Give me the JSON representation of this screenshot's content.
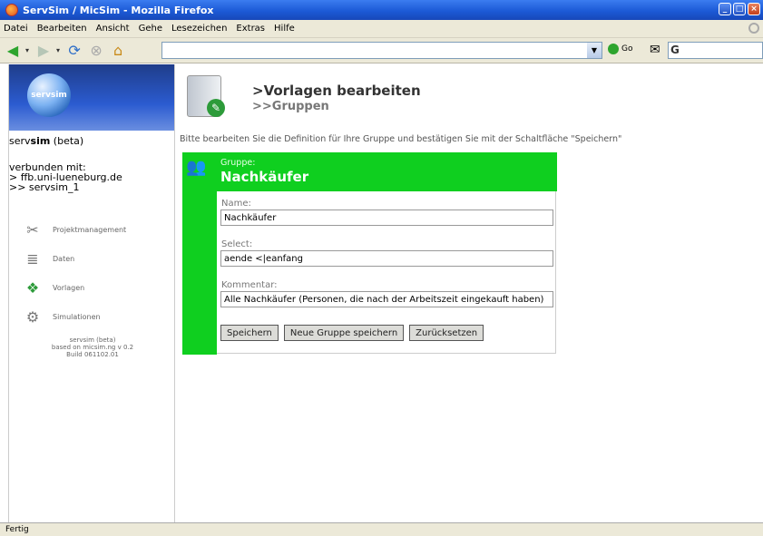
{
  "window": {
    "title": "ServSim / MicSim - Mozilla Firefox"
  },
  "menu": [
    "Datei",
    "Bearbeiten",
    "Ansicht",
    "Gehe",
    "Lesezeichen",
    "Extras",
    "Hilfe"
  ],
  "toolbar": {
    "go_label": "Go",
    "search_engine_glyph": "G"
  },
  "sidebar": {
    "logo_text": "servsim",
    "app_name_plain_a": "serv",
    "app_name_bold": "sim",
    "app_name_plain_b": " (beta)",
    "connected_label": "verbunden mit:",
    "connected_host": "> ffb.uni-lueneburg.de",
    "connected_db": ">> servsim_1",
    "nav": [
      {
        "label": "Projektmanagement",
        "icon": "tools-icon"
      },
      {
        "label": "Daten",
        "icon": "database-icon"
      },
      {
        "label": "Vorlagen",
        "icon": "templates-icon"
      },
      {
        "label": "Simulationen",
        "icon": "gears-icon"
      }
    ],
    "version_line1": "servsim (beta)",
    "version_line2": "based on micsim.ng v 0.2",
    "version_line3": "Build 061102.01"
  },
  "main": {
    "heading": ">Vorlagen bearbeiten",
    "subheading": ">>Gruppen",
    "intro": "Bitte bearbeiten Sie die Definition für Ihre Gruppe und bestätigen Sie mit der Schaltfläche \"Speichern\"",
    "group_label": "Gruppe:",
    "group_name": "Nachkäufer",
    "fields": {
      "name_label": "Name:",
      "name_value": "Nachkäufer",
      "select_label": "Select:",
      "select_value": "aende <|eanfang",
      "comment_label": "Kommentar:",
      "comment_value": "Alle Nachkäufer (Personen, die nach der Arbeitszeit eingekauft haben)"
    },
    "buttons": {
      "save": "Speichern",
      "save_new": "Neue Gruppe speichern",
      "reset": "Zurücksetzen"
    }
  },
  "status": {
    "text": "Fertig"
  },
  "colors": {
    "accent_green": "#0fcf1f",
    "titlebar_blue": "#1c5ad6"
  }
}
